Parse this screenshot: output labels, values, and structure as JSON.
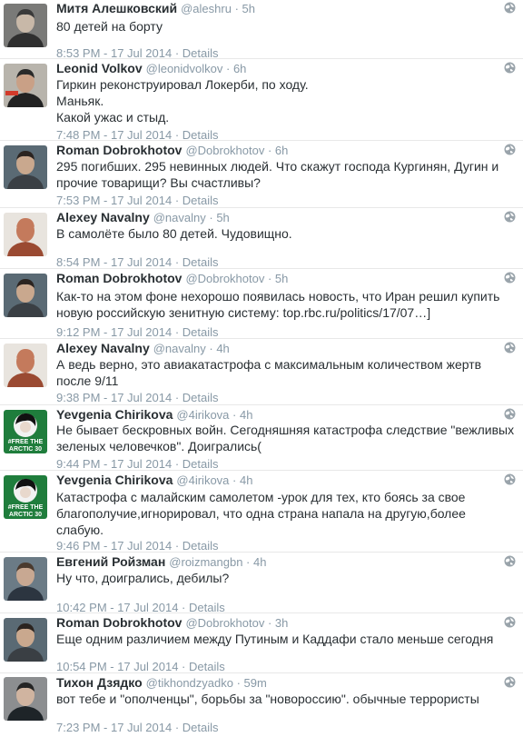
{
  "tweets": [
    {
      "name": "Митя Алешковский",
      "handle": "@aleshru",
      "age": "5h",
      "lines": [
        "80 детей на борту"
      ],
      "time": "8:53 PM - 17 Jul 2014",
      "details": "Details"
    },
    {
      "name": "Leonid Volkov",
      "handle": "@leonidvolkov",
      "age": "6h",
      "lines": [
        "Гиркин реконструировал Локерби, по ходу.",
        "Маньяк.",
        "Какой ужас и стыд."
      ],
      "time": "7:48 PM - 17 Jul 2014",
      "details": "Details"
    },
    {
      "name": "Roman Dobrokhotov",
      "handle": "@Dobrokhotov",
      "age": "6h",
      "lines": [
        "295 погибших. 295 невинных людей. Что скажут господа Кургинян, Дугин и",
        "прочие товарищи? Вы счастливы?"
      ],
      "time": "7:53 PM - 17 Jul 2014",
      "details": "Details"
    },
    {
      "name": "Alexey Navalny",
      "handle": "@navalny",
      "age": "5h",
      "lines": [
        "В самолёте было 80 детей. Чудовищно."
      ],
      "time": "8:54 PM - 17 Jul 2014",
      "details": "Details"
    },
    {
      "name": "Roman Dobrokhotov",
      "handle": "@Dobrokhotov",
      "age": "5h",
      "lines": [
        "Как-то на этом фоне нехорошо появилась новость, что Иран решил купить",
        "новую российскую зенитную систему: top.rbc.ru/politics/17/07…]"
      ],
      "time": "9:12 PM - 17 Jul 2014",
      "details": "Details"
    },
    {
      "name": "Alexey Navalny",
      "handle": "@navalny",
      "age": "4h",
      "lines": [
        "А ведь верно, это авиакатастрофа с максимальным количеством жертв",
        "после 9/11"
      ],
      "time": "9:38 PM - 17 Jul 2014",
      "details": "Details"
    },
    {
      "name": "Yevgenia Chirikova",
      "handle": "@4irikova",
      "age": "4h",
      "lines": [
        "Не бывает бескровных войн. Сегодняшняя катастрофа следствие \"вежливых",
        "зеленых человечков\". Доигрались("
      ],
      "time": "9:44 PM - 17 Jul 2014",
      "details": "Details",
      "avatar_text": [
        "#FREE THE",
        "ARCTIC 30"
      ]
    },
    {
      "name": "Yevgenia Chirikova",
      "handle": "@4irikova",
      "age": "4h",
      "lines": [
        "Катастрофа с малайским самолетом -урок для тех, кто боясь за свое",
        "благополучие,игнорировал, что одна страна напала на другую,более",
        "слабую."
      ],
      "time": "9:46 PM - 17 Jul 2014",
      "details": "Details",
      "avatar_text": [
        "#FREE THE",
        "ARCTIC 30"
      ]
    },
    {
      "name": "Евгений Ройзман",
      "handle": "@roizmangbn",
      "age": "4h",
      "lines": [
        "Ну что, доигрались, дебилы?"
      ],
      "time": "10:42 PM - 17 Jul 2014",
      "details": "Details"
    },
    {
      "name": "Roman Dobrokhotov",
      "handle": "@Dobrokhotov",
      "age": "3h",
      "lines": [
        "Еще одним различием между Путиным и Каддафи стало меньше сегодня"
      ],
      "time": "10:54 PM - 17 Jul 2014",
      "details": "Details"
    },
    {
      "name": "Тихон Дзядко",
      "handle": "@tikhondzyadko",
      "age": "59m",
      "lines": [
        "вот тебе и \"ополченцы\", борьбы за \"новороссию\". обычные террористы"
      ],
      "time": "7:23 PM - 17 Jul 2014",
      "details": "Details"
    }
  ]
}
